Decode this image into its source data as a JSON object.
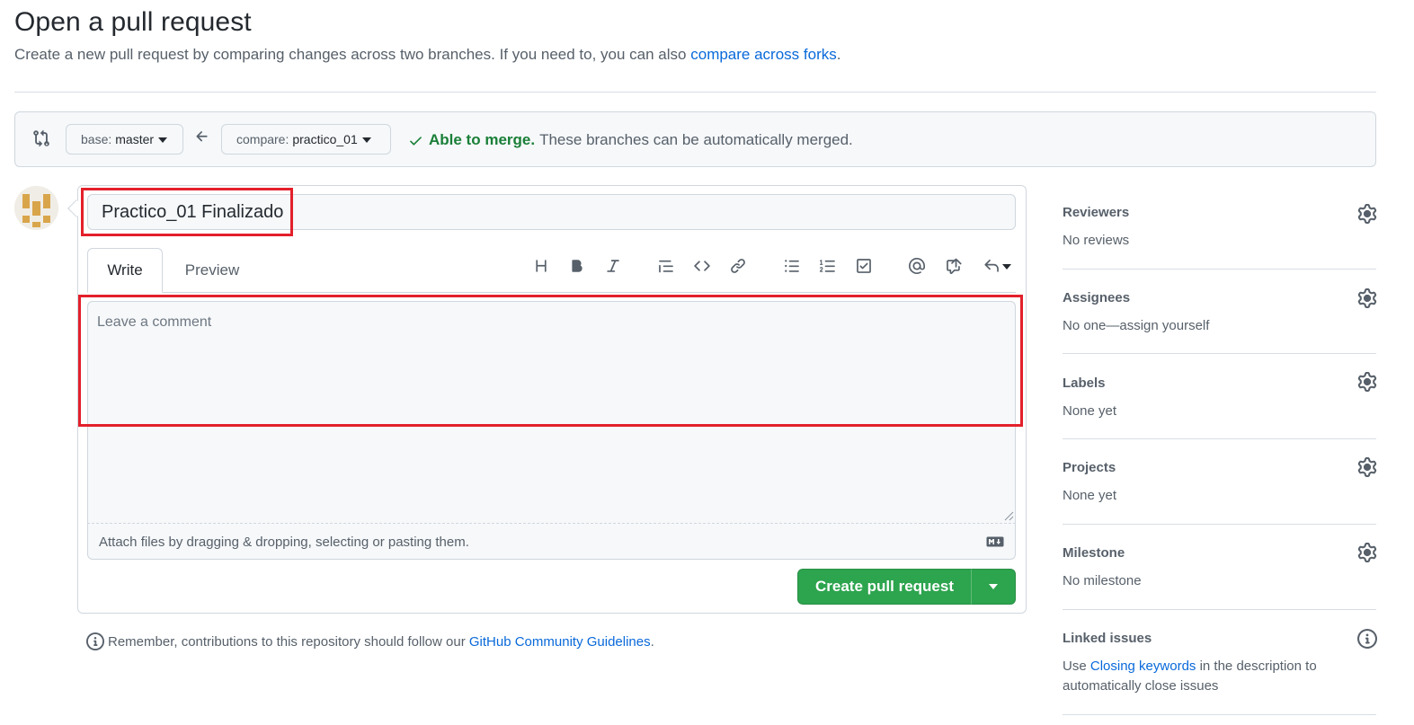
{
  "header": {
    "title": "Open a pull request",
    "subtitle": "Create a new pull request by comparing changes across two branches. If you need to, you can also",
    "compare_link": "compare across forks",
    "subtitle_end": "."
  },
  "compare": {
    "base_label": "base:",
    "base_value": "master",
    "compare_label": "compare:",
    "compare_value": "practico_01",
    "merge_ok": "Able to merge.",
    "merge_text": "These branches can be automatically merged."
  },
  "form": {
    "title_value": "Practico_01 Finalizado",
    "tabs": {
      "write": "Write",
      "preview": "Preview"
    },
    "comment_placeholder": "Leave a comment",
    "attach_text": "Attach files by dragging & dropping, selecting or pasting them.",
    "submit_label": "Create pull request",
    "toolbar": [
      "heading-icon",
      "bold-icon",
      "italic-icon",
      "quote-icon",
      "code-icon",
      "link-icon",
      "unordered-list-icon",
      "ordered-list-icon",
      "task-list-icon",
      "mention-icon",
      "cross-reference-icon",
      "reply-icon"
    ]
  },
  "footer": {
    "remember_text": "Remember, contributions to this repository should follow our",
    "guidelines_link": "GitHub Community Guidelines",
    "remember_end": "."
  },
  "sidebar": {
    "reviewers": {
      "title": "Reviewers",
      "value": "No reviews"
    },
    "assignees": {
      "title": "Assignees",
      "value": "No one—assign yourself"
    },
    "labels": {
      "title": "Labels",
      "value": "None yet"
    },
    "projects": {
      "title": "Projects",
      "value": "None yet"
    },
    "milestone": {
      "title": "Milestone",
      "value": "No milestone"
    },
    "linked_issues": {
      "title": "Linked issues",
      "pre": "Use",
      "link": "Closing keywords",
      "post": "in the description to automatically close issues"
    }
  },
  "colors": {
    "accent_green": "#2da44e",
    "merge_green": "#1a7f37",
    "link_blue": "#0969da",
    "highlight_red": "#e3202b"
  }
}
